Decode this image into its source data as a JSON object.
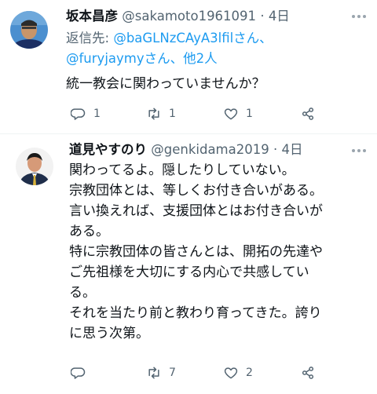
{
  "tweets": [
    {
      "author_name": "坂本昌彦",
      "handle": "@sakamoto1961091",
      "dot": "·",
      "time": "4日",
      "reply_label": "返信先:",
      "reply_link_1": "@baGLNzCAyA3lfilさん、",
      "reply_link_2": "@furyjaymyさん、",
      "reply_link_3": "他2人",
      "lines": [
        "統一教会に関わっていませんか？"
      ],
      "reply_count": "1",
      "retweet_count": "1",
      "like_count": "1",
      "share_count": ""
    },
    {
      "author_name": "道見やすのり",
      "handle": "@genkidama2019",
      "dot": "·",
      "time": "4日",
      "lines": [
        "関わってるよ。隠したりしていない。",
        "宗教団体とは、等しくお付き合いがある。",
        "言い換えれば、支援団体とはお付き合いが",
        "ある。",
        "特に宗教団体の皆さんとは、開拓の先達や",
        "ご先祖様を大切にする内心で共感してい",
        "る。",
        "それを当たり前と教わり育ってきた。誇り",
        "に思う次第。"
      ],
      "reply_count": "",
      "retweet_count": "7",
      "like_count": "2",
      "share_count": ""
    }
  ],
  "colors": {
    "text": "#0f1419",
    "secondary": "#536471",
    "link": "#1d9bf0",
    "divider": "#eff3f4"
  },
  "icons": {
    "reply": "reply-icon",
    "retweet": "retweet-icon",
    "like": "heart-icon",
    "share": "share-icon",
    "more": "more-icon"
  }
}
